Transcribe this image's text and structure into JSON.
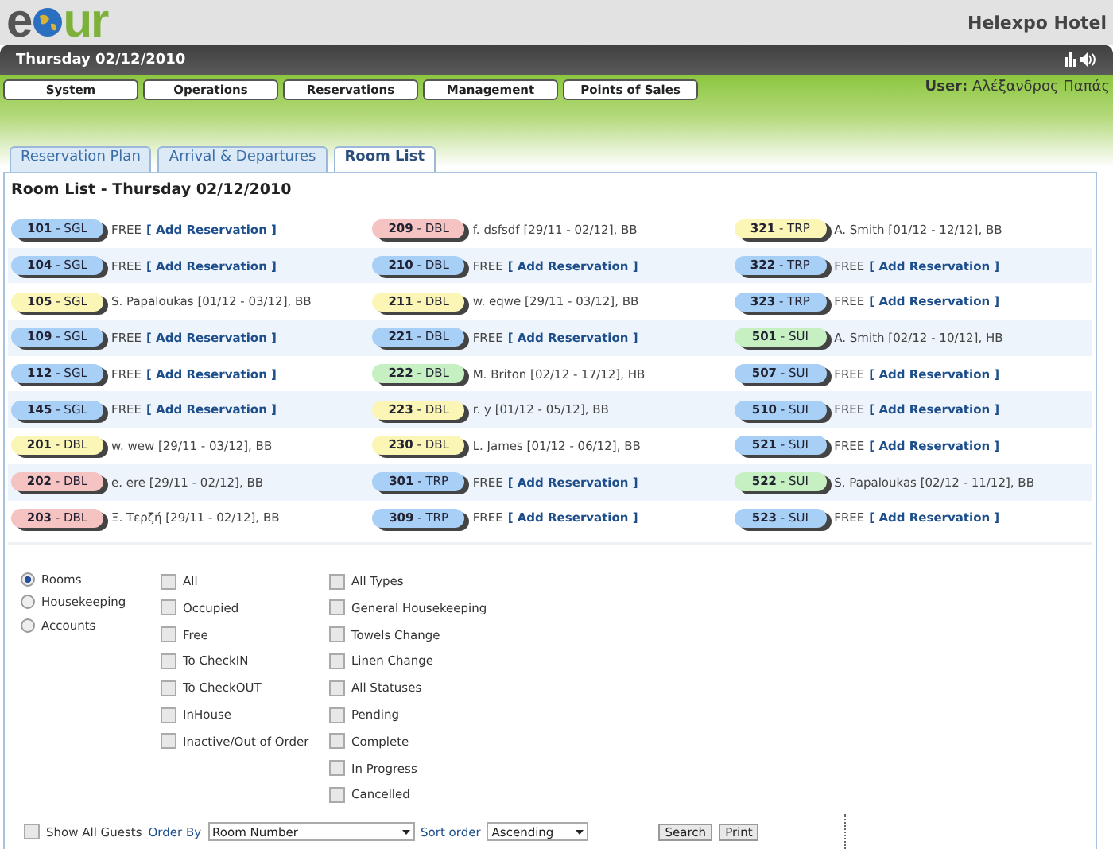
{
  "header": {
    "logo_start": "e",
    "logo_end": "ur",
    "hotel": "Helexpo Hotel"
  },
  "date_bar": {
    "date": "Thursday 02/12/2010"
  },
  "menu": [
    "System",
    "Operations",
    "Reservations",
    "Management",
    "Points of Sales"
  ],
  "user": {
    "label": "User:",
    "name": "Αλέξανδρος Παπάς"
  },
  "tabs": [
    {
      "label": "Reservation Plan",
      "selected": false
    },
    {
      "label": "Arrival & Departures",
      "selected": false
    },
    {
      "label": "Room List",
      "selected": true
    }
  ],
  "title": "Room List - Thursday 02/12/2010",
  "columns": [
    {
      "rooms": [
        {
          "room": "**101** - SGL",
          "color": "#a8cff5",
          "kind": "free",
          "status": "FREE",
          "link": "[ Add Reservation ]"
        },
        {
          "room": "**104** - SGL",
          "color": "#a8cff5",
          "kind": "free",
          "status": "FREE",
          "link": "[ Add Reservation ]"
        },
        {
          "room": "**105** - SGL",
          "color": "#fbf6b6",
          "kind": "occupied",
          "guest": "S. Papaloukas [01/12 - 03/12], BB"
        },
        {
          "room": "**109** - SGL",
          "color": "#a8cff5",
          "kind": "free",
          "status": "FREE",
          "link": "[ Add Reservation ]"
        },
        {
          "room": "**112** - SGL",
          "color": "#a8cff5",
          "kind": "free",
          "status": "FREE",
          "link": "[ Add Reservation ]"
        },
        {
          "room": "**145** - SGL",
          "color": "#a8cff5",
          "kind": "free",
          "status": "FREE",
          "link": "[ Add Reservation ]"
        },
        {
          "room": "**201** - DBL",
          "color": "#fbf6b6",
          "kind": "occupied",
          "guest": "w. wew [29/11 - 03/12], BB"
        },
        {
          "room": "**202** - DBL",
          "color": "#f6c3c3",
          "kind": "occupied",
          "guest": "e. ere [29/11 - 02/12], BB"
        },
        {
          "room": "**203** - DBL",
          "color": "#f6c3c3",
          "kind": "occupied",
          "guest": "Ξ. Τερζή [29/11 - 02/12], BB"
        }
      ]
    },
    {
      "rooms": [
        {
          "room": "**209** - DBL",
          "color": "#f6c3c3",
          "kind": "occupied",
          "guest": "f. dsfsdf [29/11 - 02/12], BB"
        },
        {
          "room": "**210** - DBL",
          "color": "#a8cff5",
          "kind": "free",
          "status": "FREE",
          "link": "[ Add Reservation ]"
        },
        {
          "room": "**211** - DBL",
          "color": "#fbf6b6",
          "kind": "occupied",
          "guest": "w. eqwe [29/11 - 03/12], BB"
        },
        {
          "room": "**221** - DBL",
          "color": "#a8cff5",
          "kind": "free",
          "status": "FREE",
          "link": "[ Add Reservation ]"
        },
        {
          "room": "**222** - DBL",
          "color": "#c6f0c2",
          "kind": "occupied",
          "guest": "M. Briton [02/12 - 17/12], HB"
        },
        {
          "room": "**223** - DBL",
          "color": "#fbf6b6",
          "kind": "occupied",
          "guest": "r. y [01/12 - 05/12], BB"
        },
        {
          "room": "**230** - DBL",
          "color": "#fbf6b6",
          "kind": "occupied",
          "guest": "L. James [01/12 - 06/12], BB"
        },
        {
          "room": "**301** - TRP",
          "color": "#a8cff5",
          "kind": "free",
          "status": "FREE",
          "link": "[ Add Reservation ]"
        },
        {
          "room": "**309** - TRP",
          "color": "#a8cff5",
          "kind": "free",
          "status": "FREE",
          "link": "[ Add Reservation ]"
        }
      ]
    },
    {
      "rooms": [
        {
          "room": "**321** - TRP",
          "color": "#fbf6b6",
          "kind": "occupied",
          "guest": "A. Smith [01/12 - 12/12], BB"
        },
        {
          "room": "**322** - TRP",
          "color": "#a8cff5",
          "kind": "free",
          "status": "FREE",
          "link": "[ Add Reservation ]"
        },
        {
          "room": "**323** - TRP",
          "color": "#a8cff5",
          "kind": "free",
          "status": "FREE",
          "link": "[ Add Reservation ]"
        },
        {
          "room": "**501** - SUI",
          "color": "#c6f0c2",
          "kind": "occupied",
          "guest": "A. Smith [02/12 - 10/12], HB"
        },
        {
          "room": "**507** - SUI",
          "color": "#a8cff5",
          "kind": "free",
          "status": "FREE",
          "link": "[ Add Reservation ]"
        },
        {
          "room": "**510** - SUI",
          "color": "#a8cff5",
          "kind": "free",
          "status": "FREE",
          "link": "[ Add Reservation ]"
        },
        {
          "room": "**521** - SUI",
          "color": "#a8cff5",
          "kind": "free",
          "status": "FREE",
          "link": "[ Add Reservation ]"
        },
        {
          "room": "**522** - SUI",
          "color": "#c6f0c2",
          "kind": "occupied",
          "guest": "S. Papaloukas [02/12 - 11/12], BB"
        },
        {
          "room": "**523** - SUI",
          "color": "#a8cff5",
          "kind": "free",
          "status": "FREE",
          "link": "[ Add Reservation ]"
        }
      ]
    }
  ],
  "views": [
    {
      "label": "Rooms",
      "selected": true
    },
    {
      "label": "Housekeeping",
      "selected": false
    },
    {
      "label": "Accounts",
      "selected": false
    }
  ],
  "room_filters": [
    {
      "label": "All",
      "checked": false
    },
    {
      "label": "Occupied",
      "checked": false
    },
    {
      "label": "Free",
      "checked": false
    },
    {
      "label": "To CheckIN",
      "checked": false
    },
    {
      "label": "To CheckOUT",
      "checked": false
    },
    {
      "label": "InHouse",
      "checked": false
    },
    {
      "label": "Inactive/Out of Order",
      "checked": false
    }
  ],
  "housekeeping_filters": [
    {
      "label": "All Types",
      "checked": false
    },
    {
      "label": "General Housekeeping",
      "checked": false
    },
    {
      "label": "Towels Change",
      "checked": false
    },
    {
      "label": "Linen Change",
      "checked": false
    },
    {
      "label": "All Statuses",
      "checked": false
    },
    {
      "label": "Pending",
      "checked": false
    },
    {
      "label": "Complete",
      "checked": false
    },
    {
      "label": "In Progress",
      "checked": false
    },
    {
      "label": "Cancelled",
      "checked": false
    }
  ],
  "bottom": {
    "show_all_guests": {
      "label": "Show All Guests",
      "checked": false
    },
    "order_by_label": "Order By",
    "order_by": "Room Number",
    "sort_label": "Sort order",
    "sort": "Ascending",
    "buttons": [
      "Search",
      "Print"
    ]
  }
}
